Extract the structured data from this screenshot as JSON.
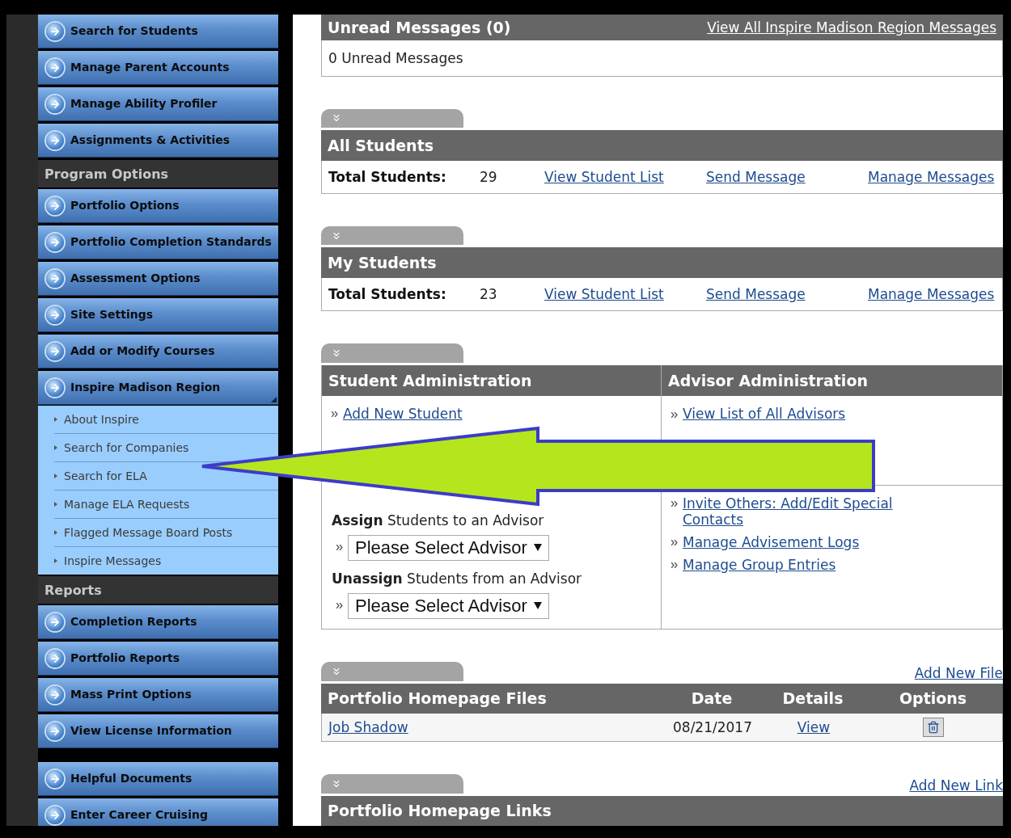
{
  "sidebar": {
    "groups": [
      {
        "items": [
          {
            "label": "Search for Students",
            "expanded": false
          },
          {
            "label": "Manage Parent Accounts",
            "expanded": false
          },
          {
            "label": "Manage Ability Profiler",
            "expanded": false
          },
          {
            "label": "Assignments & Activities",
            "expanded": false
          }
        ]
      },
      {
        "header": "Program Options",
        "items": [
          {
            "label": "Portfolio Options",
            "expanded": false
          },
          {
            "label": "Portfolio Completion Standards",
            "expanded": false
          },
          {
            "label": "Assessment Options",
            "expanded": false
          },
          {
            "label": "Site Settings",
            "expanded": false
          },
          {
            "label": "Add or Modify Courses",
            "expanded": false
          },
          {
            "label": "Inspire Madison Region",
            "expanded": true,
            "children": [
              {
                "label": "About Inspire"
              },
              {
                "label": "Search for Companies"
              },
              {
                "label": "Search for ELA"
              },
              {
                "label": "Manage ELA Requests"
              },
              {
                "label": "Flagged Message Board Posts"
              },
              {
                "label": "Inspire Messages"
              }
            ]
          }
        ]
      },
      {
        "header": "Reports",
        "items": [
          {
            "label": "Completion Reports",
            "expanded": false
          },
          {
            "label": "Portfolio Reports",
            "expanded": false
          },
          {
            "label": "Mass Print Options",
            "expanded": false
          },
          {
            "label": "View License Information",
            "expanded": false
          }
        ]
      },
      {
        "items": [
          {
            "label": "Helpful Documents",
            "expanded": false
          },
          {
            "label": "Enter Career Cruising",
            "expanded": false
          }
        ]
      }
    ]
  },
  "main": {
    "unread": {
      "title": "Unread Messages (0)",
      "link": "View All Inspire Madison Region Messages",
      "body": "0 Unread Messages"
    },
    "student_panels": [
      {
        "title": "All Students",
        "total_label": "Total Students:",
        "total": "29",
        "links": [
          "View Student List",
          "Send Message",
          "Manage Messages"
        ]
      },
      {
        "title": "My Students",
        "total_label": "Total Students:",
        "total": "23",
        "links": [
          "View Student List",
          "Send Message",
          "Manage Messages"
        ]
      }
    ],
    "administration": {
      "student": {
        "title": "Student Administration",
        "links": [
          "Add New Student"
        ],
        "assign": [
          {
            "label": "**Assign** Students to an Advisor",
            "select": "Please Select Advisor"
          },
          {
            "label": "**Unassign** Students from an Advisor",
            "select": "Please Select Advisor"
          }
        ]
      },
      "advisor": {
        "title": "Advisor Administration",
        "top_links": [
          "View List of All Advisors"
        ],
        "links": [
          "Invite Others: Add/Edit Special Contacts",
          "Manage Advisement Logs",
          "Manage Group Entries"
        ]
      }
    },
    "files": {
      "add_link": "Add New File",
      "columns": [
        "Portfolio Homepage Files",
        "Date",
        "Details",
        "Options"
      ],
      "rows": [
        {
          "name": "Job Shadow",
          "date": "08/21/2017",
          "details": "View"
        }
      ]
    },
    "links": {
      "add_link": "Add New Link",
      "title": "Portfolio Homepage Links"
    }
  }
}
